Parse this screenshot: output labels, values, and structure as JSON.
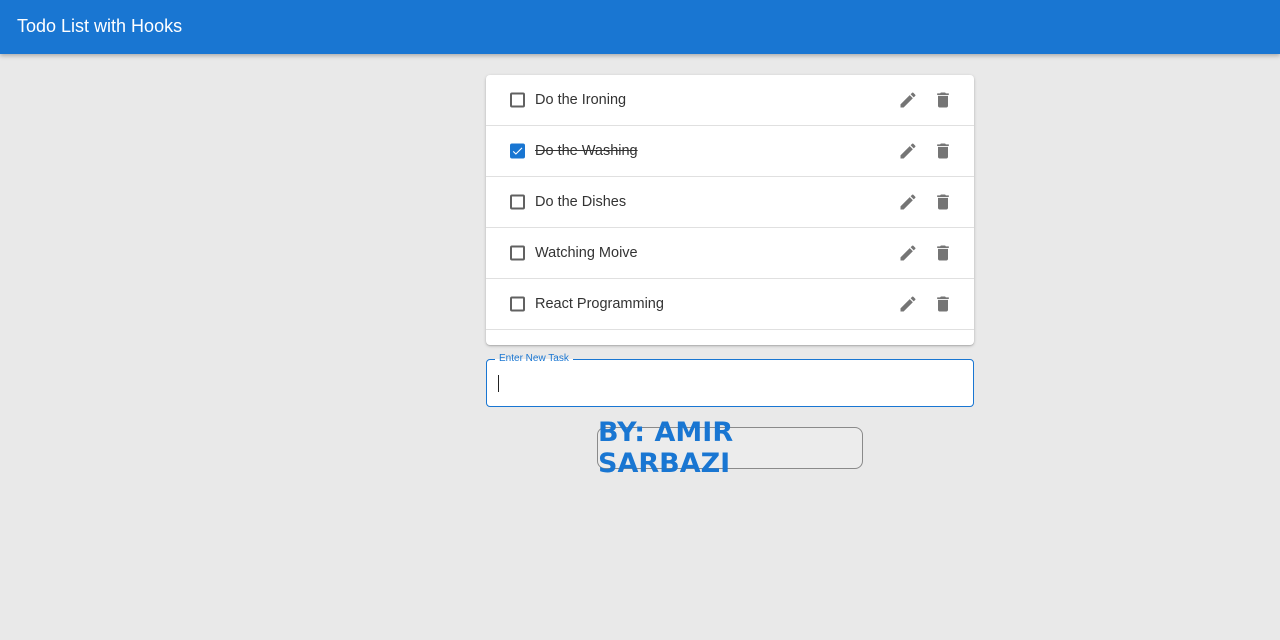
{
  "appbar": {
    "title": "Todo List with Hooks",
    "color": "#1976d2"
  },
  "todos": [
    {
      "label": "Do the Ironing",
      "completed": false,
      "edit_icon": "pencil-icon",
      "delete_icon": "trash-icon"
    },
    {
      "label": "Do the Washing",
      "completed": true,
      "edit_icon": "pencil-icon",
      "delete_icon": "trash-icon"
    },
    {
      "label": "Do the Dishes",
      "completed": false,
      "edit_icon": "pencil-icon",
      "delete_icon": "trash-icon"
    },
    {
      "label": "Watching Moive",
      "completed": false,
      "edit_icon": "pencil-icon",
      "delete_icon": "trash-icon"
    },
    {
      "label": "React Programming",
      "completed": false,
      "edit_icon": "pencil-icon",
      "delete_icon": "trash-icon"
    }
  ],
  "new_task": {
    "label": "Enter New Task",
    "value": ""
  },
  "author": {
    "text": "BY: AMIR SARBAZI"
  },
  "colors": {
    "background": "#e9e9e9",
    "accent": "#1976d2",
    "icon": "#757575"
  }
}
